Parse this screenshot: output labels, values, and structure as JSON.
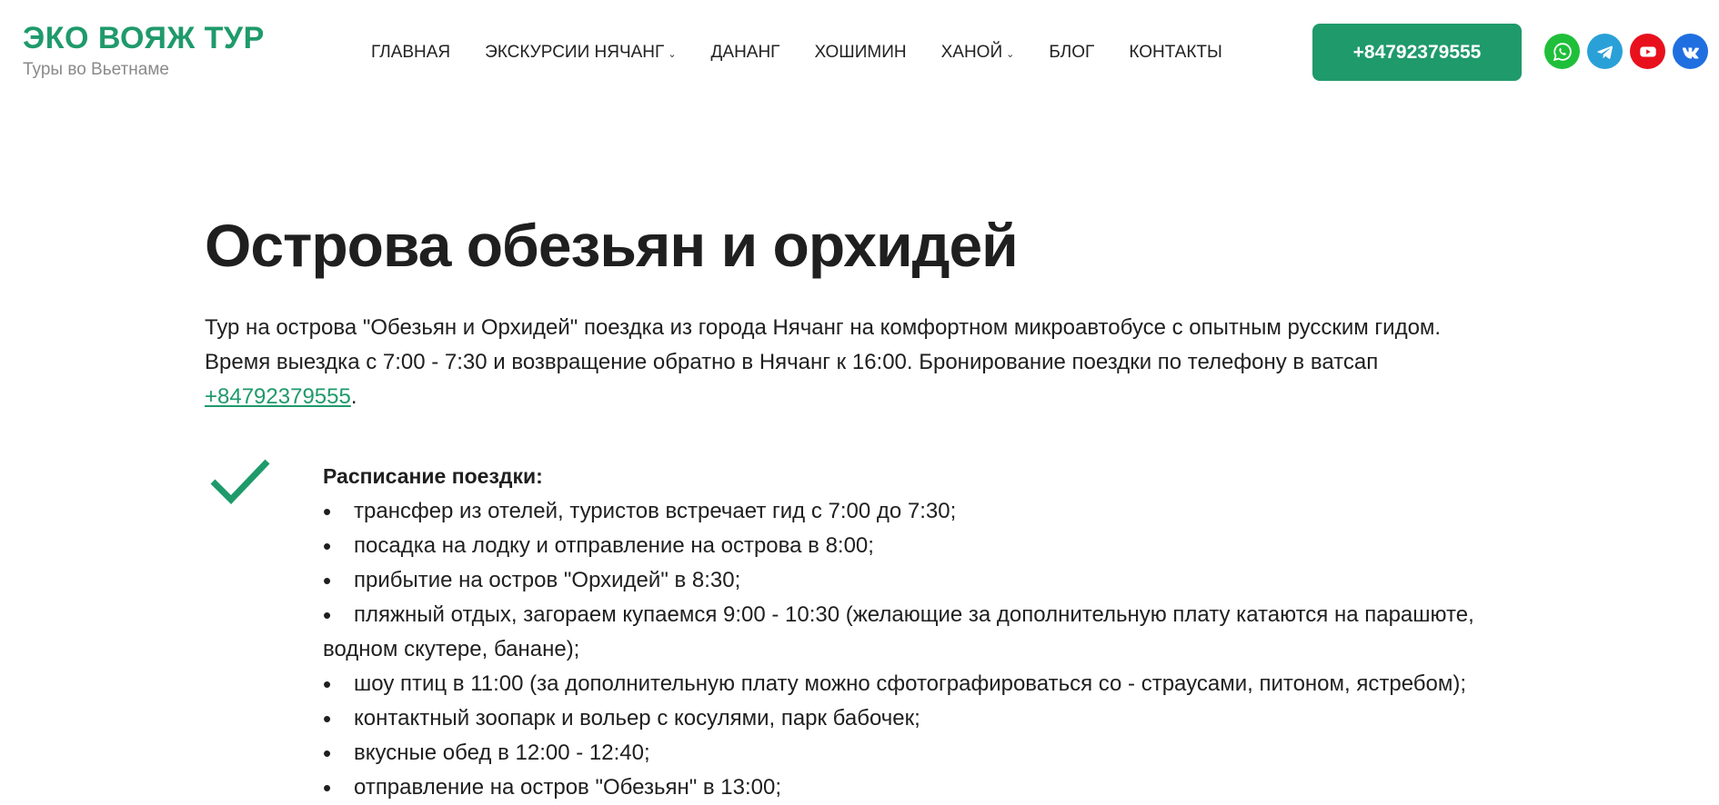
{
  "logo": {
    "title": "ЭКО ВОЯЖ ТУР",
    "subtitle": "Туры во Вьетнаме"
  },
  "nav": [
    {
      "label": "ГЛАВНАЯ",
      "has_dropdown": false
    },
    {
      "label": "ЭКСКУРСИИ НЯЧАНГ",
      "has_dropdown": true
    },
    {
      "label": "ДАНАНГ",
      "has_dropdown": false
    },
    {
      "label": "ХОШИМИН",
      "has_dropdown": false
    },
    {
      "label": "ХАНОЙ",
      "has_dropdown": true
    },
    {
      "label": "БЛОГ",
      "has_dropdown": false
    },
    {
      "label": "КОНТАКТЫ",
      "has_dropdown": false
    }
  ],
  "header": {
    "phone_label": "+84792379555"
  },
  "socials": [
    "whatsapp-icon",
    "telegram-icon",
    "youtube-icon",
    "vk-icon"
  ],
  "colors": {
    "accent": "#1f9a6b",
    "whatsapp": "#1fbf3a",
    "telegram": "#2aa0d8",
    "youtube": "#e8101c",
    "vk": "#1f6fe0"
  },
  "main": {
    "title": "Острова обезьян и орхидей",
    "intro_text": "Тур на острова \"Обезьян и Орхидей\" поездка из города Нячанг на комфортном микроавтобусе с опытным русским гидом. Время выездка с 7:00 - 7:30 и возвращение обратно в Нячанг к 16:00. Бронирование поездки по телефону в ватсап ",
    "intro_link": "+84792379555",
    "intro_end": ".",
    "schedule_title": "Расписание поездки:",
    "schedule_items": [
      "трансфер из отелей, туристов встречает гид с 7:00 до 7:30;",
      "посадка на лодку и отправление на острова в 8:00;",
      "прибытие на остров \"Орхидей\" в 8:30;",
      "пляжный отдых, загораем купаемся 9:00 - 10:30 (желающие за дополнительную плату катаются на парашюте, водном скутере, банане);",
      "шоу птиц в 11:00 (за дополнительную плату можно сфотографироваться со - страусами, питоном, ястребом);",
      "контактный зоопарк и вольер с косулями, парк бабочек;",
      "вкусные обед в 12:00 - 12:40;",
      "отправление на остров \"Обезьян\" в 13:00;"
    ]
  }
}
